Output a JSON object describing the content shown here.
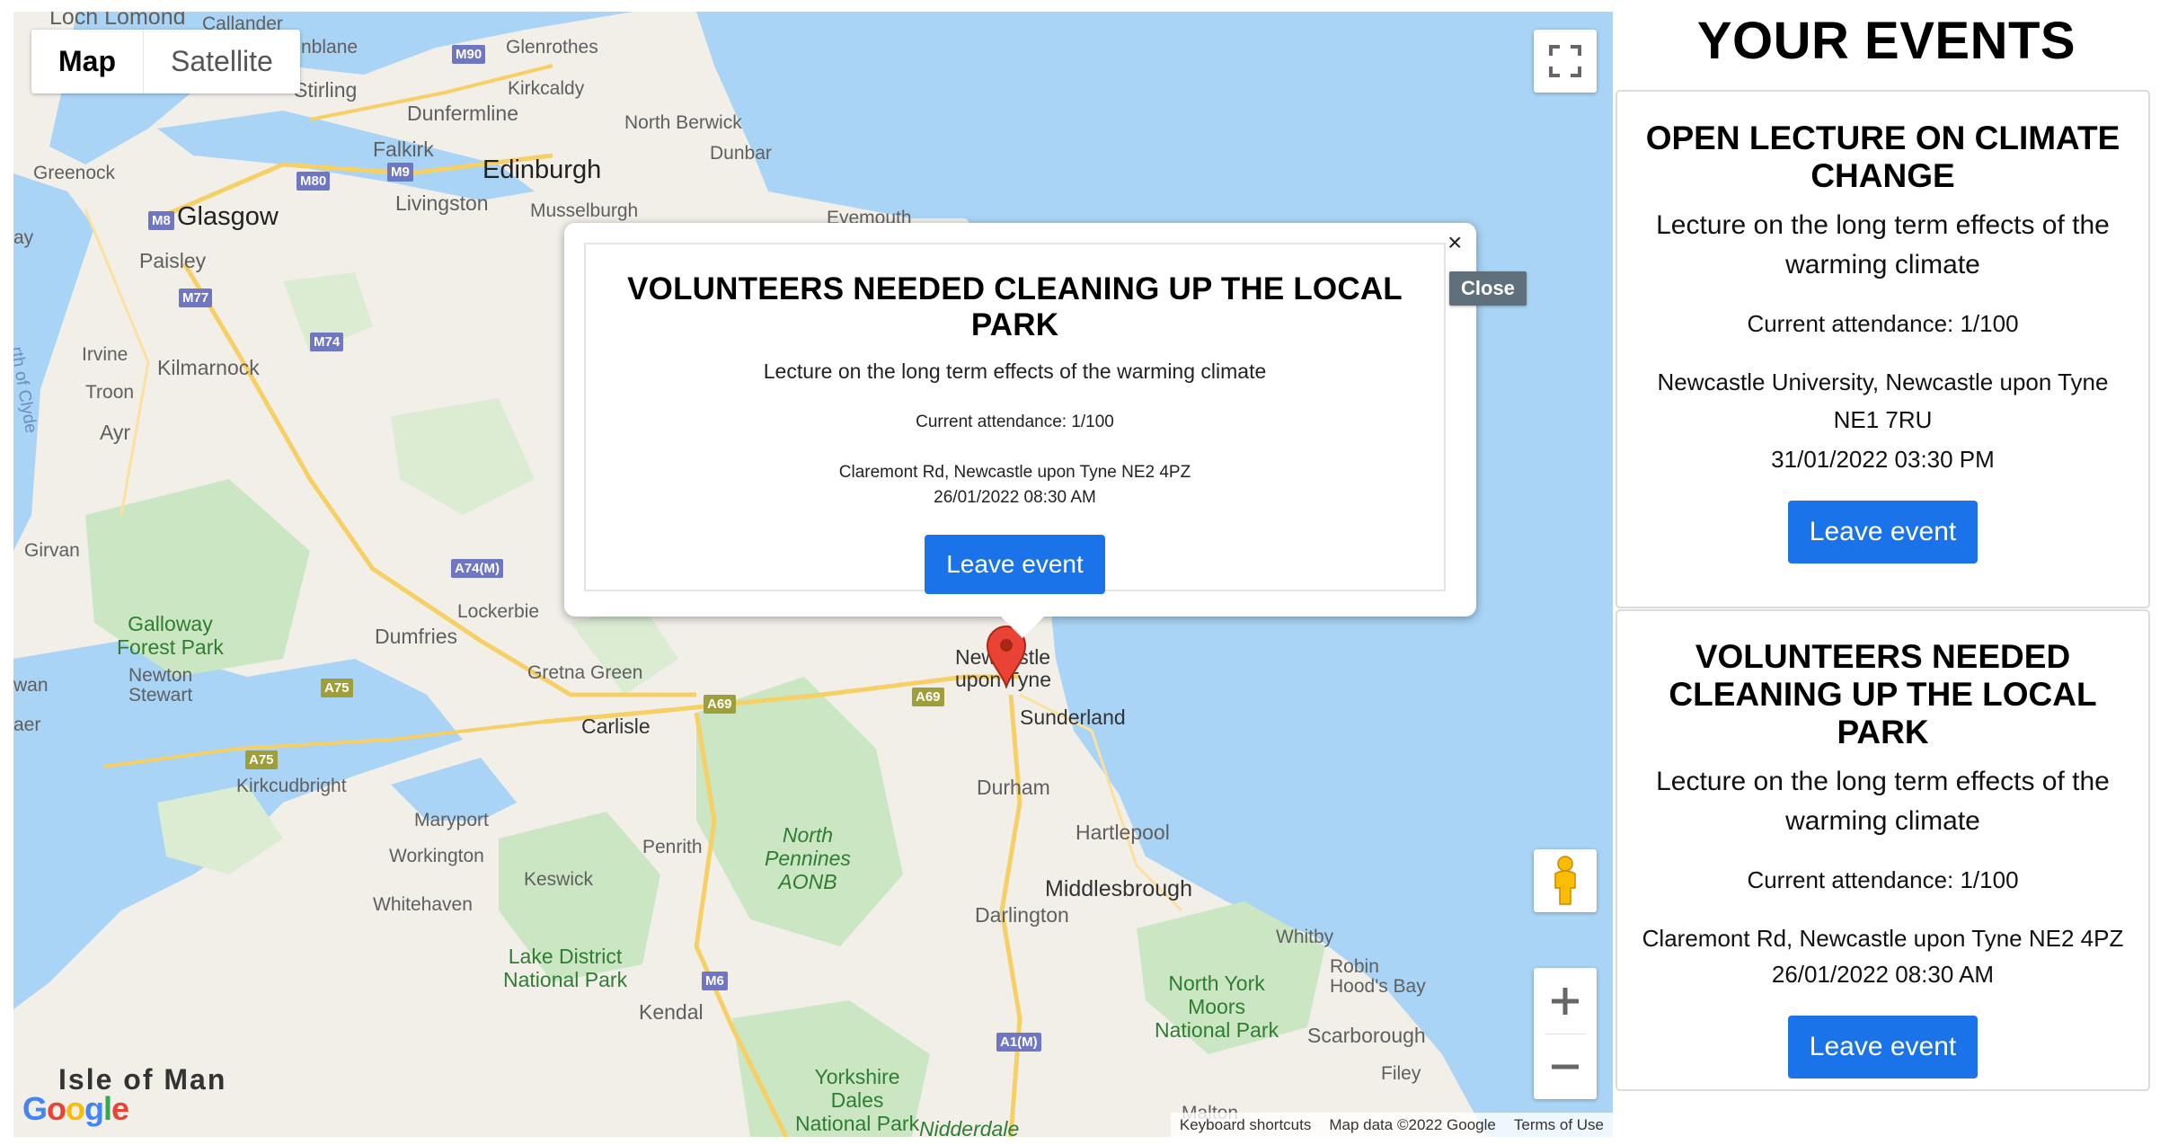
{
  "map": {
    "type_control": {
      "map_label": "Map",
      "satellite_label": "Satellite"
    },
    "places": {
      "loch_lomond": "Loch Lomond",
      "callander": "Callander",
      "dunblane": "nblane",
      "m90": "M90",
      "glenrothes": "Glenrothes",
      "stirling": "Stirling",
      "kirkcaldy": "Kirkcaldy",
      "dunfermline": "Dunfermline",
      "north_berwick": "North Berwick",
      "falkirk": "Falkirk",
      "dunbar": "Dunbar",
      "greenock": "Greenock",
      "m80": "M80",
      "m9": "M9",
      "edinburgh": "Edinburgh",
      "livingston": "Livingston",
      "musselburgh": "Musselburgh",
      "m8": "M8",
      "glasgow": "Glasgow",
      "paisley": "Paisley",
      "m77": "M77",
      "m74": "M74",
      "irvine": "Irvine",
      "kilmarnock": "Kilmarnock",
      "troon": "Troon",
      "ayr": "Ayr",
      "firth_of_clyde": "rth of Clyde",
      "girvan": "Girvan",
      "a74m": "A74(M)",
      "lockerbie": "Lockerbie",
      "galloway": "Galloway\nForest Park",
      "dumfries": "Dumfries",
      "newton_stewart": "Newton\nStewart",
      "a75_1": "A75",
      "a75_2": "A75",
      "gretna_green": "Gretna Green",
      "carlisle": "Carlisle",
      "a69_1": "A69",
      "a69_2": "A69",
      "newcastle": "Newcastle\nupon Tyne",
      "sunderland": "Sunderland",
      "kirkcudbright": "Kirkcudbright",
      "durham": "Durham",
      "maryport": "Maryport",
      "north_pennines": "North\nPennines\nAONB",
      "penrith": "Penrith",
      "hartlepool": "Hartlepool",
      "workington": "Workington",
      "keswick": "Keswick",
      "middlesbrough": "Middlesbrough",
      "whitehaven": "Whitehaven",
      "darlington": "Darlington",
      "whitby": "Whitby",
      "lake_district": "Lake District\nNational Park",
      "robin_hoods_bay": "Robin\nHood's Bay",
      "m6": "M6",
      "north_york_moors": "North York\nMoors\nNational Park",
      "kendal": "Kendal",
      "scarborough": "Scarborough",
      "a1m": "A1(M)",
      "isle_of_man": "Isle of Man",
      "filey": "Filey",
      "yorkshire_dales": "Yorkshire\nDales\nNational Park",
      "nidderdale": "Nidderdale",
      "malton": "Malton",
      "ayr_partial": "aer",
      "wan_partial": "wan",
      "ay_partial": "ay",
      "eyemouth": "Eyemouth"
    },
    "attribution": {
      "keyboard_shortcuts": "Keyboard shortcuts",
      "map_data": "Map data ©2022 Google",
      "terms": "Terms of Use"
    },
    "logo": "Google",
    "marker_color": "#ea4335"
  },
  "infowindow": {
    "title": "VOLUNTEERS NEEDED CLEANING UP THE LOCAL PARK",
    "description": "Lecture on the long term effects of the warming climate",
    "attendance": "Current attendance: 1/100",
    "address": "Claremont Rd, Newcastle upon Tyne NE2 4PZ",
    "datetime": "26/01/2022 08:30 AM",
    "leave_label": "Leave event",
    "close_symbol": "×",
    "close_tooltip": "Close"
  },
  "sidebar": {
    "title": "YOUR EVENTS",
    "events": [
      {
        "title": "OPEN LECTURE ON CLIMATE CHANGE",
        "description": "Lecture on the long term effects of the warming climate",
        "attendance": "Current attendance: 1/100",
        "address": "Newcastle University, Newcastle upon Tyne NE1 7RU",
        "datetime": "31/01/2022 03:30 PM",
        "leave_label": "Leave event"
      },
      {
        "title": "VOLUNTEERS NEEDED CLEANING UP THE LOCAL PARK",
        "description": "Lecture on the long term effects of the warming climate",
        "attendance": "Current attendance: 1/100",
        "address": "Claremont Rd, Newcastle upon Tyne NE2 4PZ",
        "datetime": "26/01/2022 08:30 AM",
        "leave_label": "Leave event"
      }
    ]
  },
  "colors": {
    "accent_button": "#1a73e8",
    "water": "#a9d4f5",
    "land": "#f2efe9",
    "park": "#cbe6c3"
  }
}
